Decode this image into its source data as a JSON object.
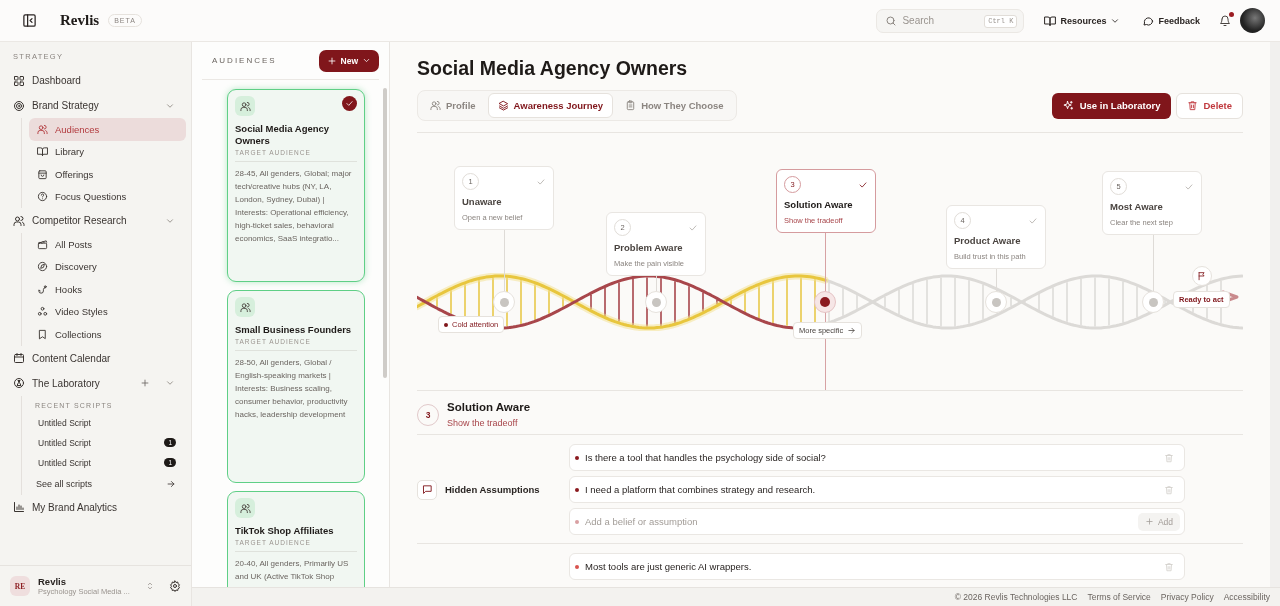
{
  "header": {
    "brand": "Revlis",
    "badge": "BETA",
    "search": {
      "placeholder": "Search",
      "shortcut": "Ctrl K"
    },
    "resources": "Resources",
    "feedback": "Feedback",
    "unread": true
  },
  "sidebar": {
    "section_label": "STRATEGY",
    "items": [
      {
        "kind": "link",
        "label": "Dashboard",
        "selected": false
      },
      {
        "kind": "group",
        "label": "Brand Strategy",
        "selected": false,
        "expanded": true,
        "children": [
          {
            "label": "Audiences",
            "selected": true
          },
          {
            "label": "Library",
            "selected": false
          },
          {
            "label": "Offerings",
            "selected": false
          },
          {
            "label": "Focus Questions",
            "selected": false
          }
        ]
      },
      {
        "kind": "group",
        "label": "Competitor Research",
        "selected": false,
        "expanded": true,
        "children": [
          {
            "label": "All Posts",
            "selected": false
          },
          {
            "label": "Discovery",
            "selected": false
          },
          {
            "label": "Hooks",
            "selected": false
          },
          {
            "label": "Video Styles",
            "selected": false
          },
          {
            "label": "Collections",
            "selected": false
          }
        ]
      },
      {
        "kind": "link",
        "label": "Content Calendar",
        "selected": false
      },
      {
        "kind": "scripts",
        "label": "The Laboratory",
        "selected": false,
        "expanded": true,
        "recent_label": "RECENT SCRIPTS",
        "scripts": [
          {
            "title": "Untitled Script",
            "selected": false
          },
          {
            "title": "Untitled Script",
            "badge": "1",
            "selected": false
          },
          {
            "title": "Untitled Script",
            "badge": "1",
            "selected": false
          }
        ],
        "see_all": "See all scripts"
      },
      {
        "kind": "link",
        "label": "My Brand Analytics",
        "selected": false
      }
    ],
    "workspace": {
      "initials": "RE",
      "name": "Revlis",
      "subtitle": "Psychology Social Media ..."
    }
  },
  "audiences": {
    "title": "AUDIENCES",
    "new_button": "New",
    "cards": [
      {
        "title": "Social Media Agency Owners",
        "subtitle": "TARGET AUDIENCE",
        "description": "28-45, All genders, Global; major tech/creative hubs (NY, LA, London, Sydney, Dubai) | Interests: Operational efficiency, high-ticket sales, behavioral economics, SaaS integratio...",
        "selected": true
      },
      {
        "title": "Small Business Founders",
        "subtitle": "TARGET AUDIENCE",
        "description": "28-50, All genders, Global / English-speaking markets | Interests: Business scaling, consumer behavior, productivity hacks, leadership development",
        "selected": false
      },
      {
        "title": "TikTok Shop Affiliates",
        "subtitle": "TARGET AUDIENCE",
        "description": "20-40, All genders, Primarily US and UK (Active TikTok Shop",
        "selected": false
      }
    ]
  },
  "main": {
    "title": "Social Media Agency Owners",
    "tabs": [
      {
        "label": "Profile",
        "selected": false
      },
      {
        "label": "Awareness Journey",
        "selected": true
      },
      {
        "label": "How They Choose",
        "selected": false
      }
    ],
    "primary_button": "Use in Laboratory",
    "delete_button": "Delete",
    "journey": {
      "start_label": "Cold attention",
      "middle_label": "More specific",
      "end_label": "Ready to act",
      "stages": [
        {
          "number": "1",
          "title": "Unaware",
          "subtitle": "Open a new belief",
          "checked": true,
          "selected": false
        },
        {
          "number": "2",
          "title": "Problem Aware",
          "subtitle": "Make the pain visible",
          "checked": true,
          "selected": false
        },
        {
          "number": "3",
          "title": "Solution Aware",
          "subtitle": "Show the tradeoff",
          "checked": true,
          "selected": true
        },
        {
          "number": "4",
          "title": "Product Aware",
          "subtitle": "Build trust in this path",
          "checked": true,
          "selected": false
        },
        {
          "number": "5",
          "title": "Most Aware",
          "subtitle": "Clear the next step",
          "checked": true,
          "selected": false
        }
      ]
    },
    "detail": {
      "number": "3",
      "title": "Solution Aware",
      "subtitle": "Show the tradeoff"
    },
    "sections": [
      {
        "title": "Hidden Assumptions",
        "color": "#8b1a1f",
        "items": [
          "Is there a tool that handles the psychology side of social?",
          "I need a platform that combines strategy and research."
        ],
        "add_placeholder": "Add a belief or assumption",
        "add_button": "Add"
      },
      {
        "color": "#d9534f",
        "items": [
          "Most tools are just generic AI wrappers."
        ]
      }
    ]
  },
  "footer": {
    "copyright": "© 2026 Revlis Technologies LLC",
    "links": [
      "Terms of Service",
      "Privacy Policy",
      "Accessibility"
    ]
  }
}
